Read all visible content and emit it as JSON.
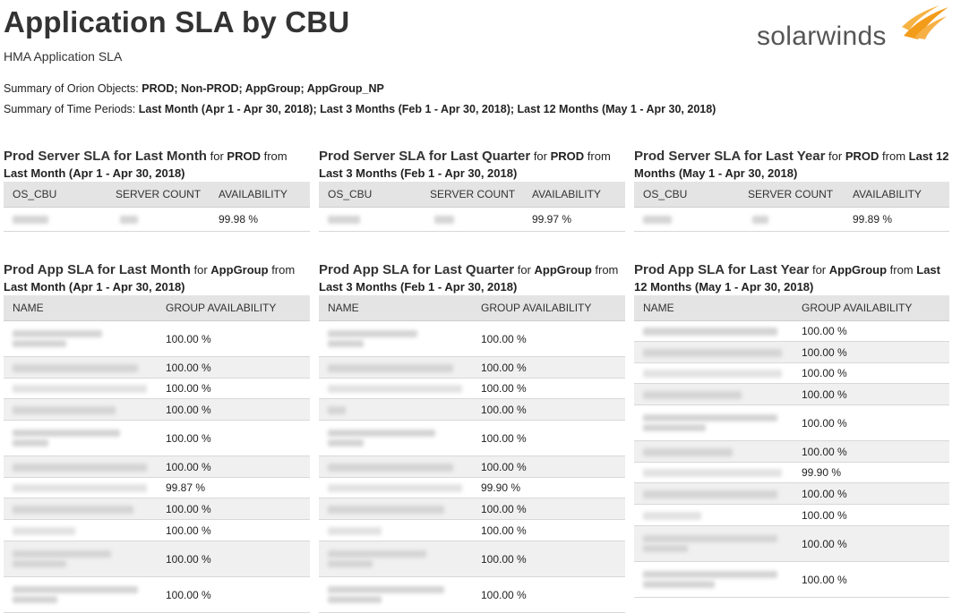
{
  "header": {
    "title": "Application SLA by CBU",
    "subtitle": "HMA Application SLA",
    "logo_text": "solarwinds",
    "summary_objects_label": "Summary of Orion Objects:",
    "summary_objects_value": "PROD; Non-PROD; AppGroup; AppGroup_NP",
    "summary_periods_label": "Summary of Time Periods:",
    "summary_periods_value": "Last Month (Apr 1 - Apr 30, 2018); Last 3 Months (Feb 1 - Apr 30, 2018); Last 12 Months (May 1 - Apr 30, 2018)"
  },
  "server_panels": [
    {
      "title": "Prod Server SLA for Last Month",
      "for_label": "for",
      "object": "PROD",
      "from_label": "from",
      "period": "Last Month (Apr 1 - Apr 30, 2018)",
      "columns": [
        "OS_CBU",
        "SERVER COUNT",
        "AVAILABILITY"
      ],
      "availability": "99.98 %"
    },
    {
      "title": "Prod Server SLA for Last Quarter",
      "for_label": "for",
      "object": "PROD",
      "from_label": "from",
      "period": "Last 3 Months (Feb 1 - Apr 30, 2018)",
      "columns": [
        "OS_CBU",
        "SERVER COUNT",
        "AVAILABILITY"
      ],
      "availability": "99.97 %"
    },
    {
      "title": "Prod Server SLA for Last Year",
      "for_label": "for",
      "object": "PROD",
      "from_label": "from",
      "period": "Last 12 Months (May 1 - Apr 30, 2018)",
      "columns": [
        "OS_CBU",
        "SERVER COUNT",
        "AVAILABILITY"
      ],
      "availability": "99.89 %"
    }
  ],
  "app_panels": [
    {
      "title": "Prod App SLA for Last Month",
      "for_label": "for",
      "object": "AppGroup",
      "from_label": "from",
      "period": "Last Month (Apr 1 - Apr 30, 2018)",
      "columns": [
        "NAME",
        "GROUP AVAILABILITY"
      ],
      "rows": [
        "100.00 %",
        "100.00 %",
        "100.00 %",
        "100.00 %",
        "100.00 %",
        "100.00 %",
        "99.87 %",
        "100.00 %",
        "100.00 %",
        "100.00 %",
        "100.00 %"
      ]
    },
    {
      "title": "Prod App SLA for Last Quarter",
      "for_label": "for",
      "object": "AppGroup",
      "from_label": "from",
      "period": "Last 3 Months (Feb 1 - Apr 30, 2018)",
      "columns": [
        "NAME",
        "GROUP AVAILABILITY"
      ],
      "rows": [
        "100.00 %",
        "100.00 %",
        "100.00 %",
        "100.00 %",
        "100.00 %",
        "100.00 %",
        "99.90 %",
        "100.00 %",
        "100.00 %",
        "100.00 %",
        "100.00 %"
      ]
    },
    {
      "title": "Prod App SLA for Last Year",
      "for_label": "for",
      "object": "AppGroup",
      "from_label": "from",
      "period": "Last 12 Months (May 1 - Apr 30, 2018)",
      "columns": [
        "NAME",
        "GROUP AVAILABILITY"
      ],
      "rows": [
        "100.00 %",
        "100.00 %",
        "100.00 %",
        "100.00 %",
        "100.00 %",
        "100.00 %",
        "99.90 %",
        "100.00 %",
        "100.00 %",
        "100.00 %",
        "100.00 %"
      ]
    }
  ],
  "colors": {
    "logo_flame": "#f39c1a",
    "header_bg": "#e4e4e4",
    "alt_row": "#f0f0f0"
  }
}
